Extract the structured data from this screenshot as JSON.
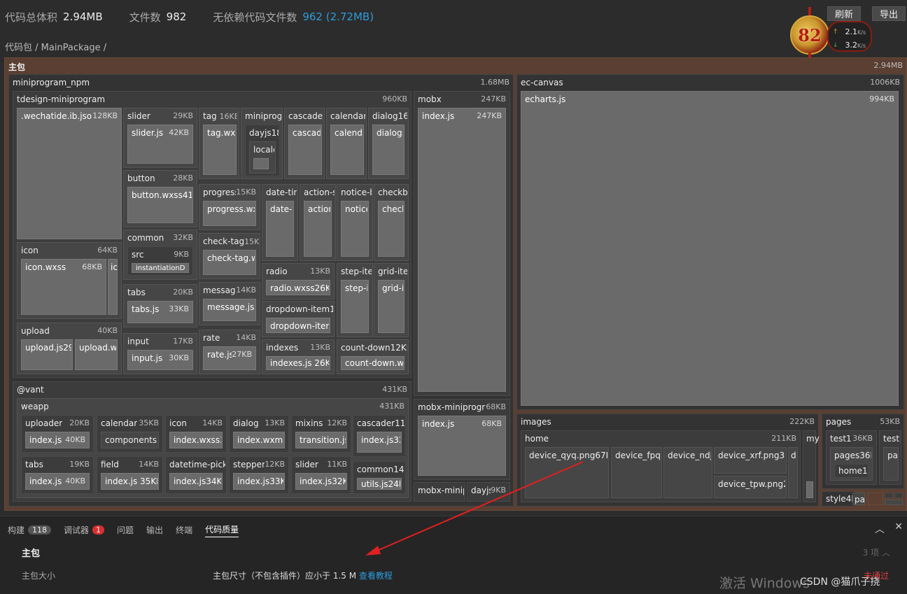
{
  "header": {
    "total_label": "代码总体积",
    "total_value": "2.94MB",
    "files_label": "文件数",
    "files_value": "982",
    "nodep_label": "无依赖代码文件数",
    "nodep_value": "962 (2.72MB)",
    "breadcrumb": "代码包 / MainPackage /",
    "refresh_label": "刷新",
    "export_label": "导出",
    "score": "82",
    "upload_speed": "2.1",
    "download_speed": "3.2",
    "speed_unit": "K/s",
    "accent": "#2d9cdb"
  },
  "treemap": {
    "root": {
      "name": "主包",
      "size": "2.94MB"
    },
    "npm": {
      "name": "miniprogram_npm",
      "size": "1.68MB"
    },
    "tdesign": {
      "name": "tdesign-miniprogram",
      "size": "960KB"
    },
    "ecanvas": {
      "name": "ec-canvas",
      "size": "1006KB"
    },
    "echarts": {
      "name": "echarts.js",
      "size": "994KB"
    },
    "wechatide": {
      "name": ".wechatide.ib.json",
      "size": "128KB"
    },
    "slider": {
      "name": "slider",
      "size": "29KB"
    },
    "slider_js": {
      "name": "slider.js",
      "size": "42KB"
    },
    "tag": {
      "name": "tag",
      "size": "16KB"
    },
    "tag_file": {
      "name": "tag.wxss"
    },
    "miniprog": {
      "name": "miniprogr"
    },
    "dayjs": {
      "name": "dayjs18"
    },
    "locale": {
      "name": "locale"
    },
    "cascader1": {
      "name": "cascader1"
    },
    "cascader1_file": {
      "name": "cascade"
    },
    "calendar1": {
      "name": "calendar1"
    },
    "calendar1_file": {
      "name": "calenda"
    },
    "dialog1": {
      "name": "dialog16K"
    },
    "dialog1_file": {
      "name": "dialog.j"
    },
    "button": {
      "name": "button",
      "size": "28KB"
    },
    "button_file": {
      "name": "button.wxss41KB"
    },
    "progress": {
      "name": "progress",
      "size": "15KB"
    },
    "progress_file": {
      "name": "progress.wxss"
    },
    "datetime1": {
      "name": "date-tim"
    },
    "datetime1_file": {
      "name": "date-t"
    },
    "actionsheet": {
      "name": "action-sh"
    },
    "actionsheet_file": {
      "name": "action"
    },
    "noticebar": {
      "name": "notice-b"
    },
    "noticebar_file": {
      "name": "notice"
    },
    "checkbox": {
      "name": "checkbo"
    },
    "checkbox_file": {
      "name": "checkb"
    },
    "icon": {
      "name": "icon",
      "size": "64KB"
    },
    "icon_file": {
      "name": "icon.wxss",
      "size": "68KB"
    },
    "icon_file2": {
      "name": "ic"
    },
    "common": {
      "name": "common",
      "size": "32KB"
    },
    "src": {
      "name": "src",
      "size": "9KB"
    },
    "inst": {
      "name": "instantiationD"
    },
    "checktag": {
      "name": "check-tag",
      "size": "15KB"
    },
    "checktag_file": {
      "name": "check-tag.wx"
    },
    "radio": {
      "name": "radio",
      "size": "13KB"
    },
    "radio_file": {
      "name": "radio.wxss26KB"
    },
    "stepitem": {
      "name": "step-iter"
    },
    "stepitem_file": {
      "name": "step-i"
    },
    "griditem": {
      "name": "grid-iter"
    },
    "griditem_file": {
      "name": "grid-it"
    },
    "tabs": {
      "name": "tabs",
      "size": "20KB"
    },
    "tabs_file": {
      "name": "tabs.js",
      "size": "33KB"
    },
    "message": {
      "name": "message",
      "size": "14KB"
    },
    "message_file": {
      "name": "message.js27"
    },
    "dropdown": {
      "name": "dropdown-item13"
    },
    "dropdown_file": {
      "name": "dropdown-item."
    },
    "upload": {
      "name": "upload",
      "size": "40KB"
    },
    "upload_js": {
      "name": "upload.js29K"
    },
    "upload_wx": {
      "name": "upload.wx"
    },
    "input": {
      "name": "input",
      "size": "17KB"
    },
    "input_file": {
      "name": "input.js",
      "size": "30KB"
    },
    "rate": {
      "name": "rate",
      "size": "14KB"
    },
    "rate_file": {
      "name": "rate.js",
      "size": "27KB"
    },
    "indexes": {
      "name": "indexes",
      "size": "13KB"
    },
    "indexes_file": {
      "name": "indexes.js 26KB"
    },
    "countdown": {
      "name": "count-down12KB"
    },
    "countdown_file": {
      "name": "count-down.wx"
    },
    "mobx": {
      "name": "mobx",
      "size": "247KB"
    },
    "mobx_file": {
      "name": "index.js",
      "size": "247KB"
    },
    "vant": {
      "name": "@vant",
      "size": "431KB"
    },
    "weapp": {
      "name": "weapp",
      "size": "431KB"
    },
    "v_uploader": {
      "name": "uploader",
      "size": "20KB"
    },
    "v_uploader_f": {
      "name": "index.js",
      "size": "40KB"
    },
    "v_calendar": {
      "name": "calendar",
      "size": "35KB"
    },
    "v_calendar_f": {
      "name": "components14"
    },
    "v_icon": {
      "name": "icon",
      "size": "14KB"
    },
    "v_icon_f": {
      "name": "index.wxss34"
    },
    "v_dialog": {
      "name": "dialog",
      "size": "13KB"
    },
    "v_dialog_f": {
      "name": "index.wxml34"
    },
    "v_mixins": {
      "name": "mixins",
      "size": "12KB"
    },
    "v_mixins_f": {
      "name": "transition.js3"
    },
    "v_cascader": {
      "name": "cascader11K"
    },
    "v_cascader_f": {
      "name": "index.js32"
    },
    "v_tabs": {
      "name": "tabs",
      "size": "19KB"
    },
    "v_tabs_f": {
      "name": "index.js",
      "size": "40KB"
    },
    "v_field": {
      "name": "field",
      "size": "14KB"
    },
    "v_field_f": {
      "name": "index.js 35KB"
    },
    "v_datetime": {
      "name": "datetime-picker"
    },
    "v_datetime_f": {
      "name": "index.js34KB"
    },
    "v_stepper": {
      "name": "stepper",
      "size": "12KB"
    },
    "v_stepper_f": {
      "name": "index.js33KB"
    },
    "v_slider": {
      "name": "slider",
      "size": "11KB"
    },
    "v_slider_f": {
      "name": "index.js32KB"
    },
    "v_common": {
      "name": "common14K"
    },
    "v_common_f": {
      "name": "utils.js24K"
    },
    "mobxmp": {
      "name": "mobx-miniprogram",
      "size": "68KB"
    },
    "mobxmp_file": {
      "name": "index.js",
      "size": "68KB"
    },
    "mobxmini": {
      "name": "mobx-minip"
    },
    "dayjs2": {
      "name": "dayjs",
      "size": "9KB"
    },
    "images": {
      "name": "images",
      "size": "222KB"
    },
    "home": {
      "name": "home",
      "size": "211KB"
    },
    "qyq": {
      "name": "device_qyq.png67KB"
    },
    "fpq": {
      "name": "device_fpq.p"
    },
    "ndj": {
      "name": "device_ndj.p"
    },
    "xrf": {
      "name": "device_xrf.png31K"
    },
    "d": {
      "name": "d"
    },
    "tpw": {
      "name": "device_tpw.png27"
    },
    "my": {
      "name": "my"
    },
    "pages": {
      "name": "pages",
      "size": "53KB"
    },
    "test1": {
      "name": "test1",
      "size": "36KB"
    },
    "test1_pages": {
      "name": "pages36KB"
    },
    "test1_home": {
      "name": "home18"
    },
    "test2": {
      "name": "test2"
    },
    "test2_pa": {
      "name": "pa"
    },
    "style": {
      "name": "style4K"
    },
    "pa": {
      "name": "pa"
    }
  },
  "panel": {
    "tabs": [
      {
        "label": "构建",
        "badge": "118"
      },
      {
        "label": "调试器",
        "badge": "1"
      },
      {
        "label": "问题"
      },
      {
        "label": "输出"
      },
      {
        "label": "终端"
      },
      {
        "label": "代码质量"
      }
    ],
    "section_title": "主包",
    "section_count": "3 项",
    "rule_label": "主包大小",
    "rule_desc": "主包尺寸（不包含插件）应小于 1.5 M",
    "rule_link": "查看教程",
    "rule_status": "未通过",
    "watermark": "激活 Windows",
    "csdn": "CSDN @猫爪子挠"
  }
}
